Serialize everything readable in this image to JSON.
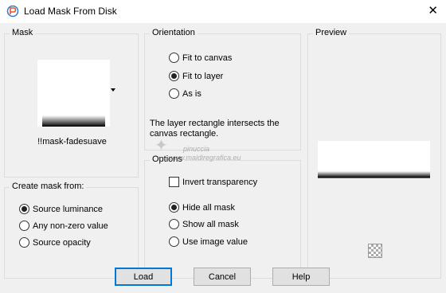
{
  "window": {
    "title": "Load Mask From Disk",
    "close_glyph": "✕",
    "app_icon": "paint-shop-pro-icon"
  },
  "mask_group": {
    "legend": "Mask",
    "mask_name": "!!mask-fadesuave"
  },
  "create_from": {
    "legend": "Create mask from:",
    "options": [
      "Source luminance",
      "Any non-zero value",
      "Source opacity"
    ],
    "selected": "Source luminance"
  },
  "orientation": {
    "legend": "Orientation",
    "options": [
      "Fit to canvas",
      "Fit to layer",
      "As is"
    ],
    "selected": "Fit to layer",
    "message": "The layer rectangle intersects the canvas rectangle."
  },
  "options_group": {
    "legend": "Options",
    "invert_label": "Invert transparency",
    "invert_checked": false,
    "mask_modes": [
      "Hide all mask",
      "Show all mask",
      "Use image value"
    ],
    "selected": "Hide all mask"
  },
  "preview": {
    "legend": "Preview"
  },
  "buttons": {
    "load": "Load",
    "cancel": "Cancel",
    "help": "Help"
  },
  "watermark": {
    "line1": "pinuccia",
    "line2": "www.maidiregrafica.eu"
  }
}
